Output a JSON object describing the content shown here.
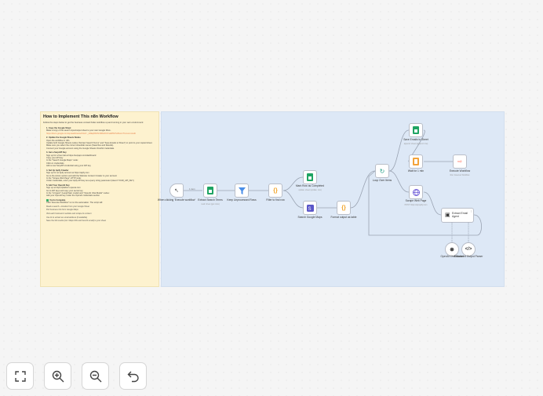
{
  "sticky_note": {
    "title": "How to Implement This n8n Workflow",
    "intro": "Follow the steps below to get the business contact finder workflow up and running in your own environment:",
    "steps": [
      {
        "title": "1. Copy the Google Sheet",
        "lines": [
          "Make a copy of the search input/output sheet to your own Google Drive."
        ],
        "link": "https://docs.google.com/spreadsheets/d/1w7-_H0EqRRx5r2MbHfUOnaW8sTiw8sxcxTtxxsxxxx/edit"
      },
      {
        "title": "2. Update the Google Sheets Nodes",
        "lines": [
          "Open the workflow in n8n.",
          "Update both Google Sheets nodes (\"Extract Search Terms\" and \"Save Emails to Sheet\") to point to your copied sheet.",
          "Make sure you select the correct sheet/tab names (Searches and Results).",
          "Connect your Google account using the Google Sheets OAuth2 credentials."
        ],
        "link": ""
      },
      {
        "title": "3. Get a SerpAPI Key",
        "lines": [
          "Sign up for a free trial at https://serpapi.com/dashboard",
          "Copy your API key",
          "In the \"Search Google Maps\" node:",
          "Click on credentials",
          "Add a new SerpAPI credential using your API key"
        ],
        "link": ""
      },
      {
        "title": "4. Set Up Apify Crawler",
        "lines": [
          "Sign up for an Apify account at https://apify.com",
          "Go to the Actors section and add the Website Content Crawler to your account",
          "In the \"Scrape Web Page\" HTTP node:",
          "Under credentials, enter your Apify API key as a query string parameter (token=YOUR_API_KEY)"
        ],
        "link": ""
      },
      {
        "title": "5. Add Your OpenAI Key",
        "lines": [
          "Sign up at https://platform.openai.com",
          "Go to API keys and copy your secret key",
          "In the \"AI Agent\" (LangChain model) and \"OpenAI Chat Model\" nodes:",
          "Add your OpenAI key under the OpenAI credentials section"
        ],
        "link": ""
      }
    ],
    "done_title": "You're Complete",
    "done_line": "Click \"Execute Workflow\" to run the automation. The script will:",
    "extras": [
      "Read a search + location from your Google Sheet",
      "Pull business info from Google Maps",
      "Visit each business's website and scrape its content",
      "Use AI to extract an email address (if available)",
      "Save the full results (incl. Maps URL and best-fit email) to your sheet"
    ]
  },
  "nodes": {
    "trigger": {
      "label": "When clicking 'Execute workflow'",
      "icon": "cursor-icon"
    },
    "extract_terms": {
      "label": "Extract Search Terms",
      "sub": "read: sheet (get rows)",
      "icon": "google-sheets-icon"
    },
    "filter": {
      "label": "Keep Unprocessed Rows",
      "icon": "filter-icon"
    },
    "filter_find": {
      "label": "Filter to find row",
      "icon": "code-icon"
    },
    "mark_complete": {
      "label": "Mark Row as Completed",
      "sub": "update: sheet (update: row)",
      "icon": "google-sheets-icon"
    },
    "search_maps": {
      "label": "Search Google Maps",
      "icon": "serpapi-icon"
    },
    "format_output": {
      "label": "Format output as table",
      "icon": "code-icon"
    },
    "loop": {
      "label": "Loop Over Items",
      "icon": "loop-icon"
    },
    "save_emails": {
      "label": "Save Emails to Sheet",
      "sub": "append: sheet (append: row)",
      "icon": "google-sheets-icon"
    },
    "wait": {
      "label": "Wait for 1 min",
      "icon": "wait-icon"
    },
    "execute_workflow": {
      "label": "Execute Workflow",
      "sub": "Run: Execute Workflow",
      "icon": "execute-workflow-icon"
    },
    "scrape": {
      "label": "Scrape Web Page",
      "sub": "POST: https://api.apify.com",
      "icon": "globe-icon"
    },
    "agent": {
      "label": "Extract Email Agent",
      "icon": "robot-icon"
    },
    "chat_model": {
      "label": "OpenAI Chat Model",
      "icon": "openai-icon"
    },
    "output_parser": {
      "label": "Structured Output Parser",
      "icon": "parser-icon"
    }
  },
  "edge_labels": {
    "trigger_out": "1 item",
    "loop_done": "done",
    "loop_loop": "loop"
  },
  "agent_ports": [
    "Chat Model",
    "Memory",
    "Tool",
    "Output Parser"
  ],
  "toolbar": {
    "zoom_to_fit": "zoom-to-fit-icon",
    "zoom_in": "zoom-in-icon",
    "zoom_out": "zoom-out-icon",
    "reset": "undo-icon"
  },
  "colors": {
    "note_bg": "#fdf2cf",
    "group_bg": "#dde8f6",
    "sheets": "#1fa463",
    "orange": "#ff6d5a",
    "accent": "#7a86d8"
  }
}
